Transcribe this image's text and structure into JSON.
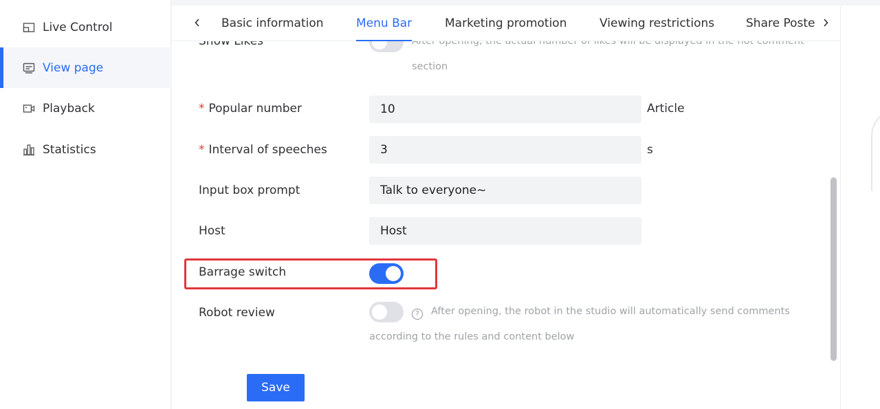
{
  "sidebar": {
    "items": [
      {
        "label": "Live Control",
        "icon": "live-control-icon"
      },
      {
        "label": "View page",
        "icon": "view-page-icon",
        "active": true
      },
      {
        "label": "Playback",
        "icon": "playback-icon"
      },
      {
        "label": "Statistics",
        "icon": "statistics-icon"
      }
    ]
  },
  "tabs": {
    "items": [
      "Basic information",
      "Menu Bar",
      "Marketing promotion",
      "Viewing restrictions",
      "Share Poste"
    ],
    "active": "Menu Bar"
  },
  "form": {
    "show_likes": {
      "label": "Show Likes",
      "hint": "After opening, the actual number of likes will be displayed in the hot comment section"
    },
    "popular_number": {
      "label": "Popular number",
      "value": "10",
      "unit": "Article",
      "required": true
    },
    "interval": {
      "label": "Interval of speeches",
      "value": "3",
      "unit": "s",
      "required": true
    },
    "input_prompt": {
      "label": "Input box prompt",
      "value": "Talk to everyone~"
    },
    "host": {
      "label": "Host",
      "value": "Host"
    },
    "barrage": {
      "label": "Barrage switch",
      "on": true
    },
    "robot": {
      "label": "Robot review",
      "on": false,
      "hint_line1": "After opening, the robot in the studio will automatically send comments",
      "hint_line2": "according to the rules and content below"
    },
    "save_label": "Save"
  },
  "colors": {
    "accent": "#2a6cf6",
    "required": "#e2363b",
    "highlight": "#e2363b"
  }
}
